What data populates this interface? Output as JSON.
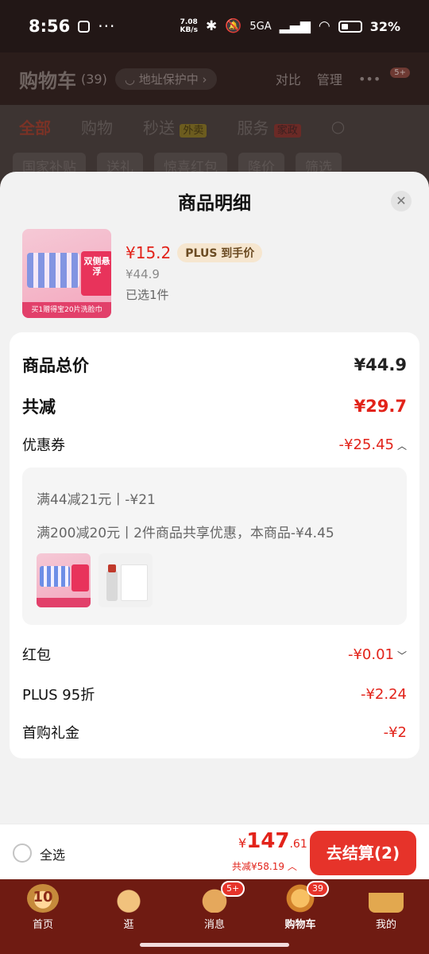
{
  "status_bar": {
    "time": "8:56",
    "net_speed_value": "7.08",
    "net_speed_unit": "KB/s",
    "network": "5GA",
    "battery": "32%"
  },
  "background_page": {
    "title": "购物车",
    "count": "(39)",
    "address_protect": "地址保护中",
    "compare": "对比",
    "manage": "管理",
    "more_badge": "5+",
    "tabs": [
      "全部",
      "购物",
      "秒送",
      "服务"
    ],
    "tab_tags": {
      "seconds": "外卖",
      "service": "家政"
    },
    "filters": [
      "国家补贴",
      "送礼",
      "惊喜红包",
      "降价",
      "筛选"
    ]
  },
  "sheet": {
    "title": "商品明细",
    "product": {
      "price": "¥15.2",
      "plus_label": "PLUS 到手价",
      "original_price": "¥44.9",
      "selected": "已选1件",
      "image_text_1": "双侧悬浮",
      "image_strip": "买1赠得宝20片洗脸巾"
    },
    "summary": {
      "total_label": "商品总价",
      "total_value": "¥44.9",
      "reduce_label": "共减",
      "reduce_value": "¥29.7",
      "coupon_label": "优惠券",
      "coupon_value": "-¥25.45",
      "coupon_details": [
        "满44减21元丨-¥21",
        "满200减20元丨2件商品共享优惠，本商品-¥4.45"
      ],
      "redpacket_label": "红包",
      "redpacket_value": "-¥0.01",
      "plus_label": "PLUS 95折",
      "plus_value": "-¥2.24",
      "first_label": "首购礼金",
      "first_value": "-¥2"
    }
  },
  "action_bar": {
    "select_all": "全选",
    "total_symbol": "¥",
    "total_int": "147",
    "total_dec": ".61",
    "saved": "共减¥58.19",
    "checkout": "去结算(2)"
  },
  "tab_bar": {
    "items": [
      "首页",
      "逛",
      "消息",
      "购物车",
      "我的"
    ],
    "badges": {
      "msg": "5+",
      "cart": "39"
    }
  },
  "icons": {
    "close": "close-icon",
    "chevron_up": "chevron-up-icon",
    "chevron_down": "chevron-down-icon"
  },
  "colors": {
    "accent_red": "#e2231a",
    "checkout_bg": "#e6332a",
    "tabbar_bg": "#6f1b12"
  }
}
